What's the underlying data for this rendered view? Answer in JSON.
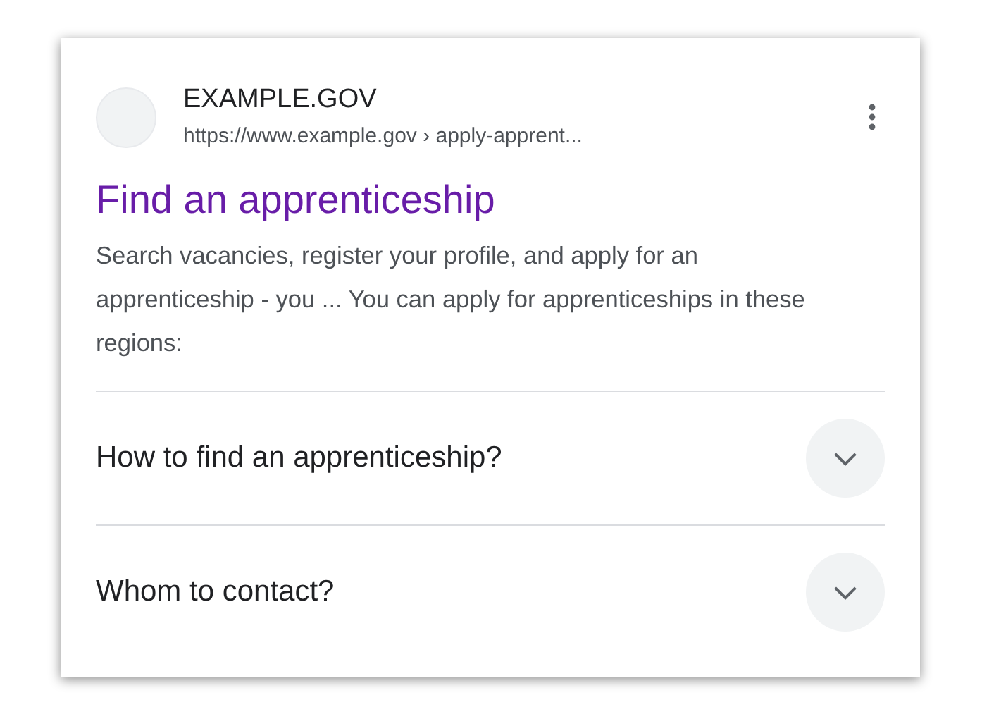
{
  "result": {
    "site_name": "EXAMPLE.GOV",
    "url": "https://www.example.gov › apply-apprent...",
    "title": "Find an apprenticeship",
    "visited": true,
    "snippet": "Search vacancies, register your profile, and apply for an apprenticeship - you ... You can apply for apprenticeships in these regions:"
  },
  "questions": [
    {
      "text": "How to find an apprenticeship?",
      "expanded": false
    },
    {
      "text": "Whom to contact?",
      "expanded": false
    }
  ]
}
